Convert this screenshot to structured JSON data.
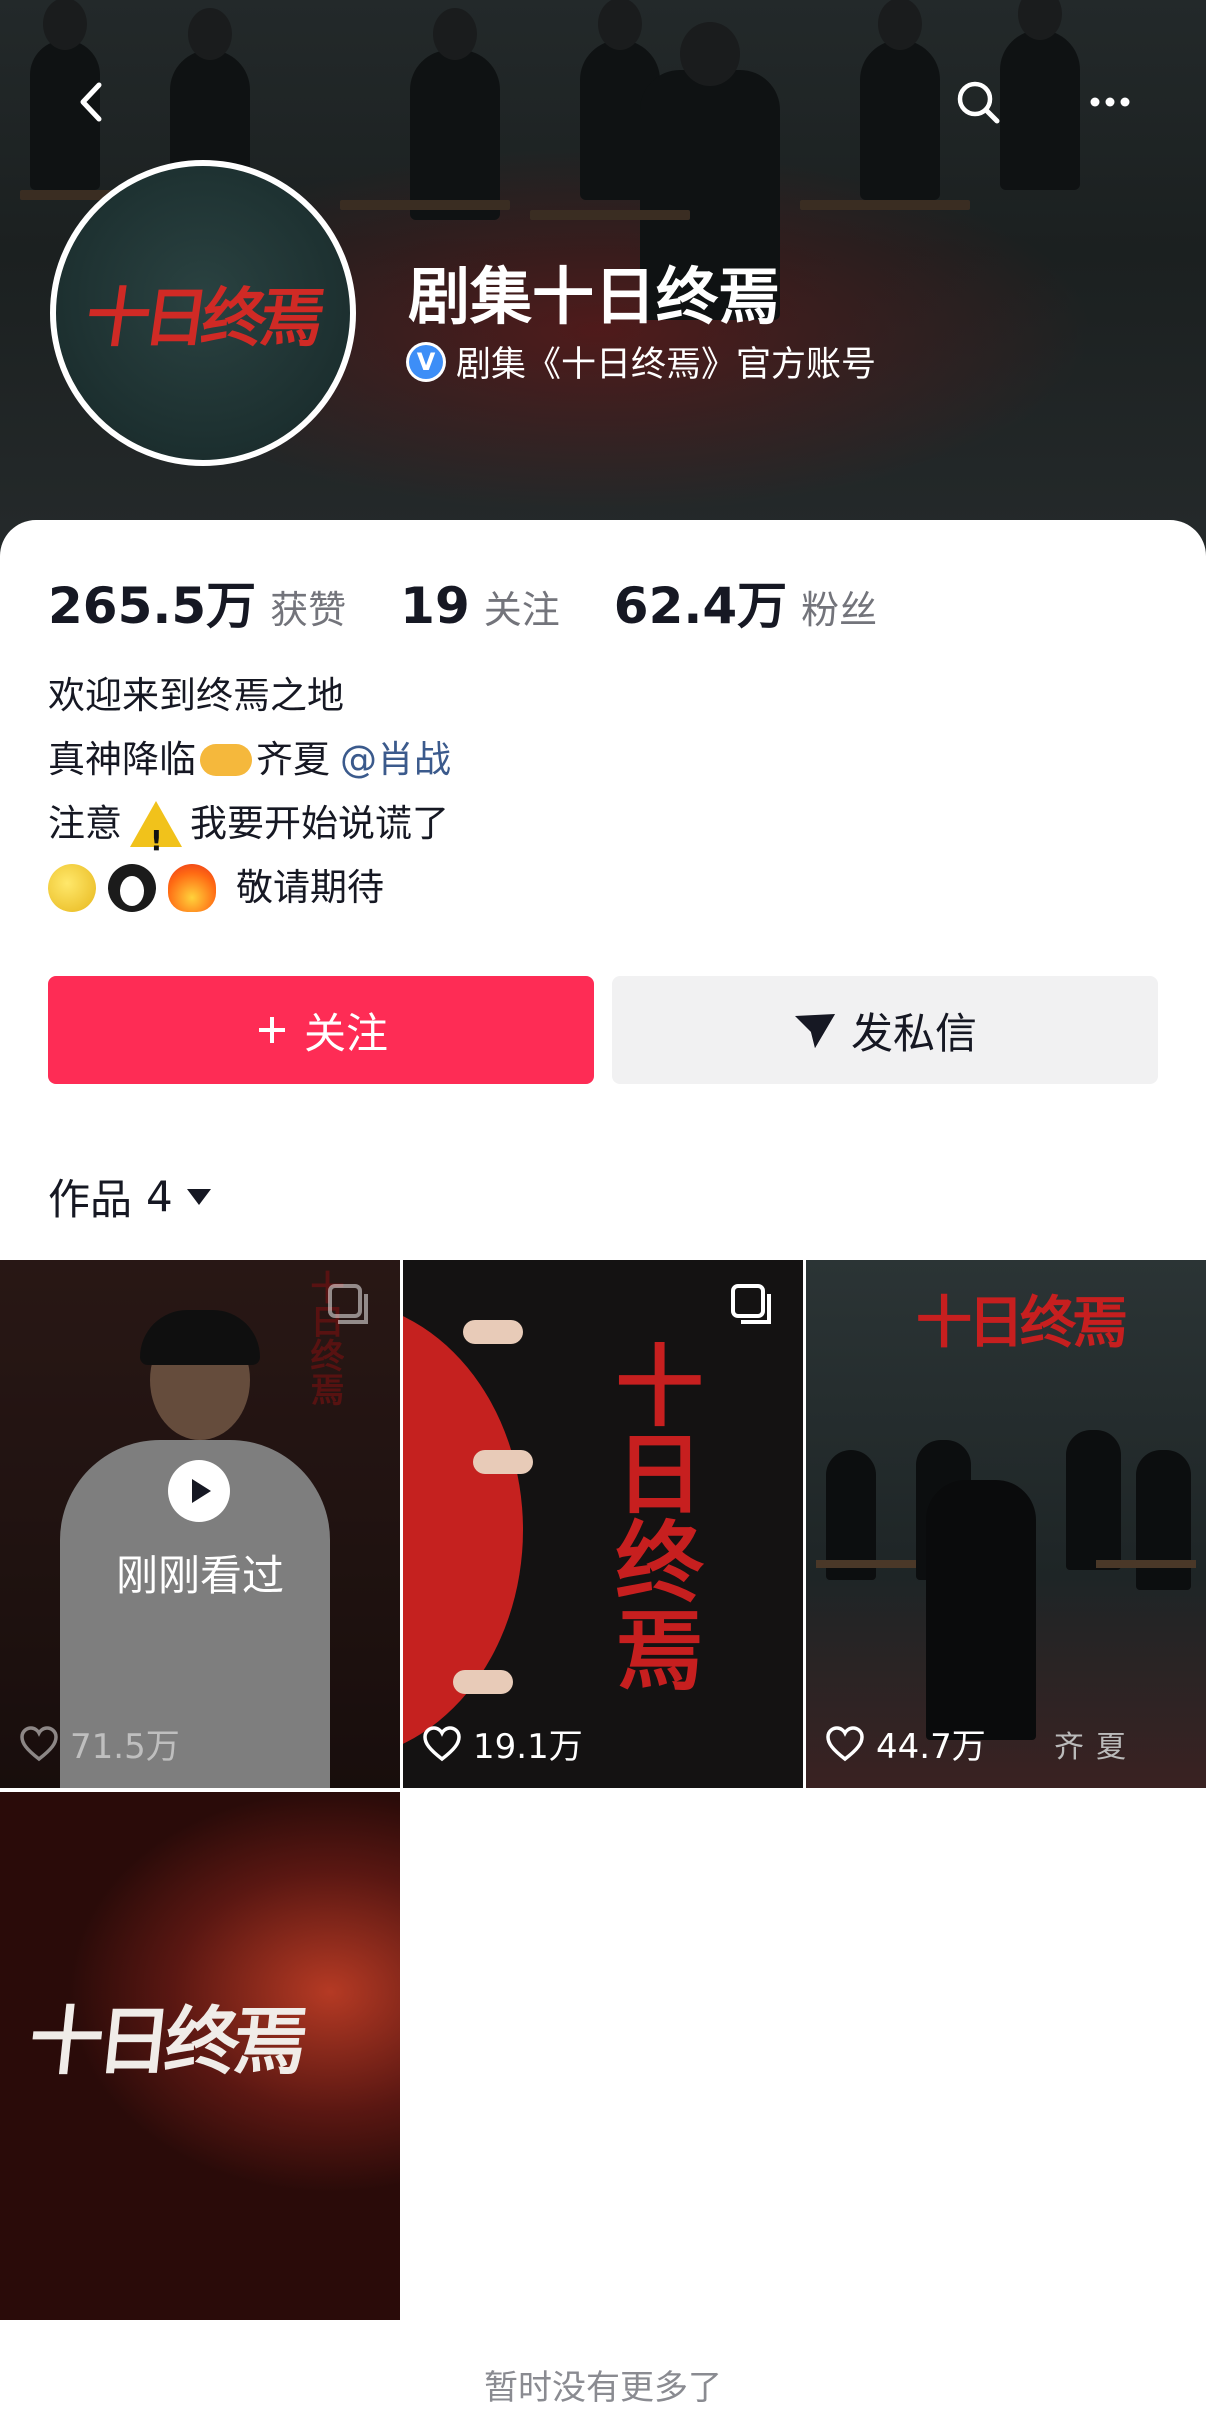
{
  "header": {
    "back_icon": "chevron-left-icon",
    "search_icon": "search-icon",
    "more_icon": "ellipsis-icon"
  },
  "profile": {
    "avatar_logo": "十日终焉",
    "name": "剧集十日终焉",
    "verified_badge": "V",
    "verified_text": "剧集《十日终焉》官方账号"
  },
  "stats": [
    {
      "value": "265.5万",
      "label": "获赞"
    },
    {
      "value": "19",
      "label": "关注"
    },
    {
      "value": "62.4万",
      "label": "粉丝"
    }
  ],
  "bio": {
    "line1": "欢迎来到终焉之地",
    "line2_text": "真神降临",
    "line2_after": "齐夏",
    "line2_mention": "@肖战",
    "line3_text": "注意",
    "line3_after": "我要开始说谎了",
    "line4_text": "敬请期待"
  },
  "actions": {
    "follow_label": "关注",
    "follow_icon": "plus-icon",
    "message_label": "发私信",
    "message_icon": "send-icon",
    "follow_color": "#fe2c55"
  },
  "works": {
    "tab_label": "作品",
    "count": "4",
    "items": [
      {
        "likes": "71.5万",
        "watched_label": "刚刚看过",
        "poster_text": "十日终焉"
      },
      {
        "likes": "19.1万",
        "poster_text": "十日终焉"
      },
      {
        "likes": "44.7万",
        "poster_text": "十日终焉",
        "caption": "齐夏"
      },
      {
        "poster_text": "十日终焉"
      }
    ]
  },
  "footer": {
    "end_text": "暂时没有更多了"
  }
}
